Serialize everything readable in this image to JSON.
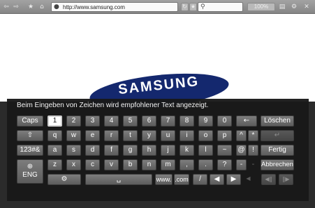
{
  "toolbar": {
    "back_icon": "⇦",
    "forward_icon": "⇨",
    "favorite_icon": "★",
    "home_icon": "⌂",
    "url": "http://www.samsung.com",
    "url_icon": "●",
    "refresh_icon": "↻",
    "bookmark_icon": "★",
    "search_icon": "⚲",
    "zoom": "100%",
    "view_icon": "▤",
    "settings_icon": "⚙",
    "close_icon": "✕"
  },
  "page": {
    "logo_text": "SAMSUNG"
  },
  "keyboard": {
    "hint": "Beim Eingeben von Zeichen wird empfohlener Text angezeigt.",
    "caps": "Caps",
    "digits": [
      "1",
      "2",
      "3",
      "4",
      "5",
      "6",
      "7",
      "8",
      "9",
      "0"
    ],
    "backspace": "←",
    "delete_label": "Löschen",
    "shift": "⇧",
    "row2": [
      "q",
      "w",
      "e",
      "r",
      "t",
      "y",
      "u",
      "i",
      "o",
      "p"
    ],
    "caret": "^",
    "asterisk": "*",
    "enter": "↵",
    "mode": "123#&",
    "row3": [
      "a",
      "s",
      "d",
      "f",
      "g",
      "h",
      "j",
      "k",
      "l",
      "~"
    ],
    "at": "@",
    "excl": "!",
    "done_label": "Fertig",
    "lang_icon": "⊕",
    "lang_label": "ENG",
    "row4": [
      "z",
      "x",
      "c",
      "v",
      "b",
      "n",
      "m",
      ",",
      ".",
      "?",
      "-"
    ],
    "dash_dim": "-",
    "cancel_label": "Abbrechen",
    "settings_icon": "⚙",
    "space": "␣",
    "www": "www.",
    "com": ".com",
    "slash": "/",
    "left": "◀",
    "right": "▶",
    "dim_a": "◀",
    "dim_b": "▶",
    "media_prev": "◀‖",
    "media_next": "‖▶"
  }
}
